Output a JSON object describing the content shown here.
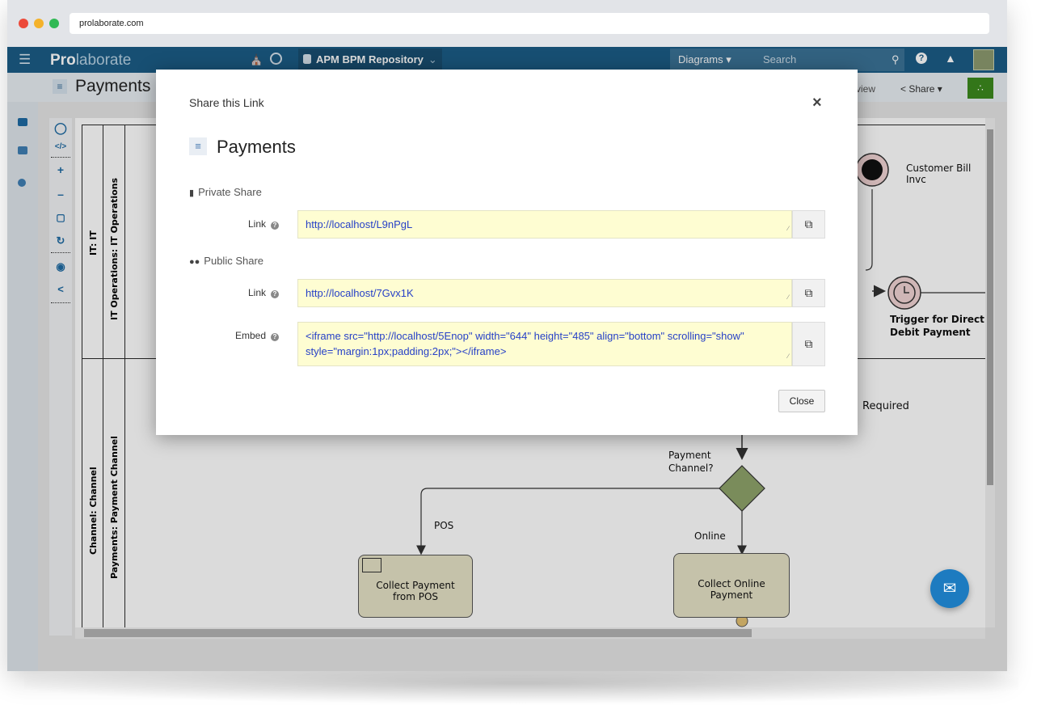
{
  "browser": {
    "url": "prolaborate.com"
  },
  "navbar": {
    "logo_bold": "Pro",
    "logo_rest": "laborate",
    "repository": "APM BPM Repository",
    "diagrams_label": "Diagrams",
    "search_placeholder": "Search"
  },
  "subheader": {
    "title": "Payments",
    "view_label": "view",
    "share_label": "Share"
  },
  "diagram": {
    "lanes": [
      "IT: IT",
      "IT Operations: IT Operations",
      "Channel: Channel",
      "Payments: Payment Channel"
    ],
    "labels": {
      "customer_bill": "Customer Bill Invc",
      "trigger_line1": "Trigger for Direct",
      "trigger_line2": "Debit Payment",
      "required": "Required",
      "payment_channel_line1": "Payment",
      "payment_channel_line2": "Channel?",
      "pos": "POS",
      "online": "Online"
    },
    "tasks": {
      "collect_pos": "Collect Payment from POS",
      "collect_online": "Collect Online Payment"
    }
  },
  "modal": {
    "header": "Share this Link",
    "title": "Payments",
    "private_share": "Private Share",
    "public_share": "Public Share",
    "link_label": "Link",
    "embed_label": "Embed",
    "private_link": "http://localhost/L9nPgL",
    "public_link": "http://localhost/7Gvx1K",
    "embed_code": "<iframe src=\"http://localhost/5Enop\" width=\"644\" height=\"485\" align=\"bottom\" scrolling=\"show\" style=\"margin:1px;padding:2px;\"></iframe>",
    "close_label": "Close"
  },
  "colors": {
    "navbar": "#1b5d86",
    "field_bg": "#fefdd2",
    "link_text": "#2741c7",
    "rss": "#3c8a1e",
    "task_fill": "#e6e2c6",
    "gateway": "#8fa36b",
    "chat": "#1d7bc0"
  },
  "icons": [
    "menu-icon",
    "home-icon",
    "clock-icon",
    "database-icon",
    "search-icon",
    "help-icon",
    "bell-icon",
    "diagram-icon",
    "share-icon",
    "rss-icon",
    "lock-icon",
    "users-icon",
    "copy-icon",
    "close-icon",
    "chat-icon"
  ]
}
